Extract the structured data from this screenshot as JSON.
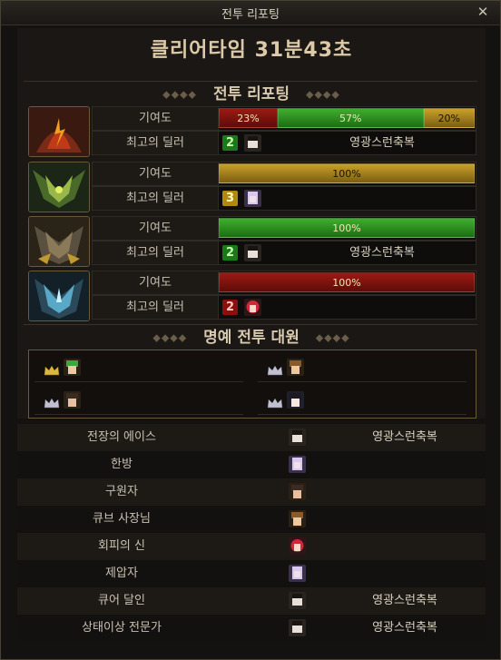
{
  "window": {
    "title": "전투 리포팅",
    "close_label": "✕"
  },
  "clear_time": "클리어타임  31분43초",
  "section_report": "전투 리포팅",
  "section_honor": "명예 전투 대원",
  "labels": {
    "contribution": "기여도",
    "top_dealer": "최고의 딜러"
  },
  "bosses": [
    {
      "icon": "fire-boss-icon",
      "segments": [
        {
          "pct": 23,
          "text": "23%",
          "color": "red"
        },
        {
          "pct": 57,
          "text": "57%",
          "color": "green"
        },
        {
          "pct": 20,
          "text": "20%",
          "color": "gold"
        }
      ],
      "dealer_rank": "2",
      "dealer_rank_color": "green",
      "dealer_name": "영광스런축복"
    },
    {
      "icon": "forest-boss-icon",
      "segments": [
        {
          "pct": 100,
          "text": "100%",
          "color": "gold"
        }
      ],
      "dealer_rank": "3",
      "dealer_rank_color": "gold",
      "dealer_name": ""
    },
    {
      "icon": "gold-boss-icon",
      "segments": [
        {
          "pct": 100,
          "text": "100%",
          "color": "green"
        }
      ],
      "dealer_rank": "2",
      "dealer_rank_color": "green",
      "dealer_name": "영광스런축복"
    },
    {
      "icon": "ice-boss-icon",
      "segments": [
        {
          "pct": 100,
          "text": "100%",
          "color": "red"
        }
      ],
      "dealer_rank": "2",
      "dealer_rank_color": "red",
      "dealer_name": ""
    }
  ],
  "honor_members": [
    {
      "avatar": "green-hair-avatar"
    },
    {
      "avatar": "brown-hair-avatar"
    },
    {
      "avatar": "dark-hair-avatar"
    },
    {
      "avatar": "silver-hair-avatar"
    }
  ],
  "awards": [
    {
      "title": "전장의 에이스",
      "name": "영광스런축복"
    },
    {
      "title": "한방",
      "name": ""
    },
    {
      "title": "구원자",
      "name": ""
    },
    {
      "title": "큐브 사장님",
      "name": ""
    },
    {
      "title": "회피의 신",
      "name": ""
    },
    {
      "title": "제압자",
      "name": ""
    },
    {
      "title": "큐어 달인",
      "name": "영광스런축복"
    },
    {
      "title": "상태이상 전문가",
      "name": "영광스런축복"
    }
  ]
}
